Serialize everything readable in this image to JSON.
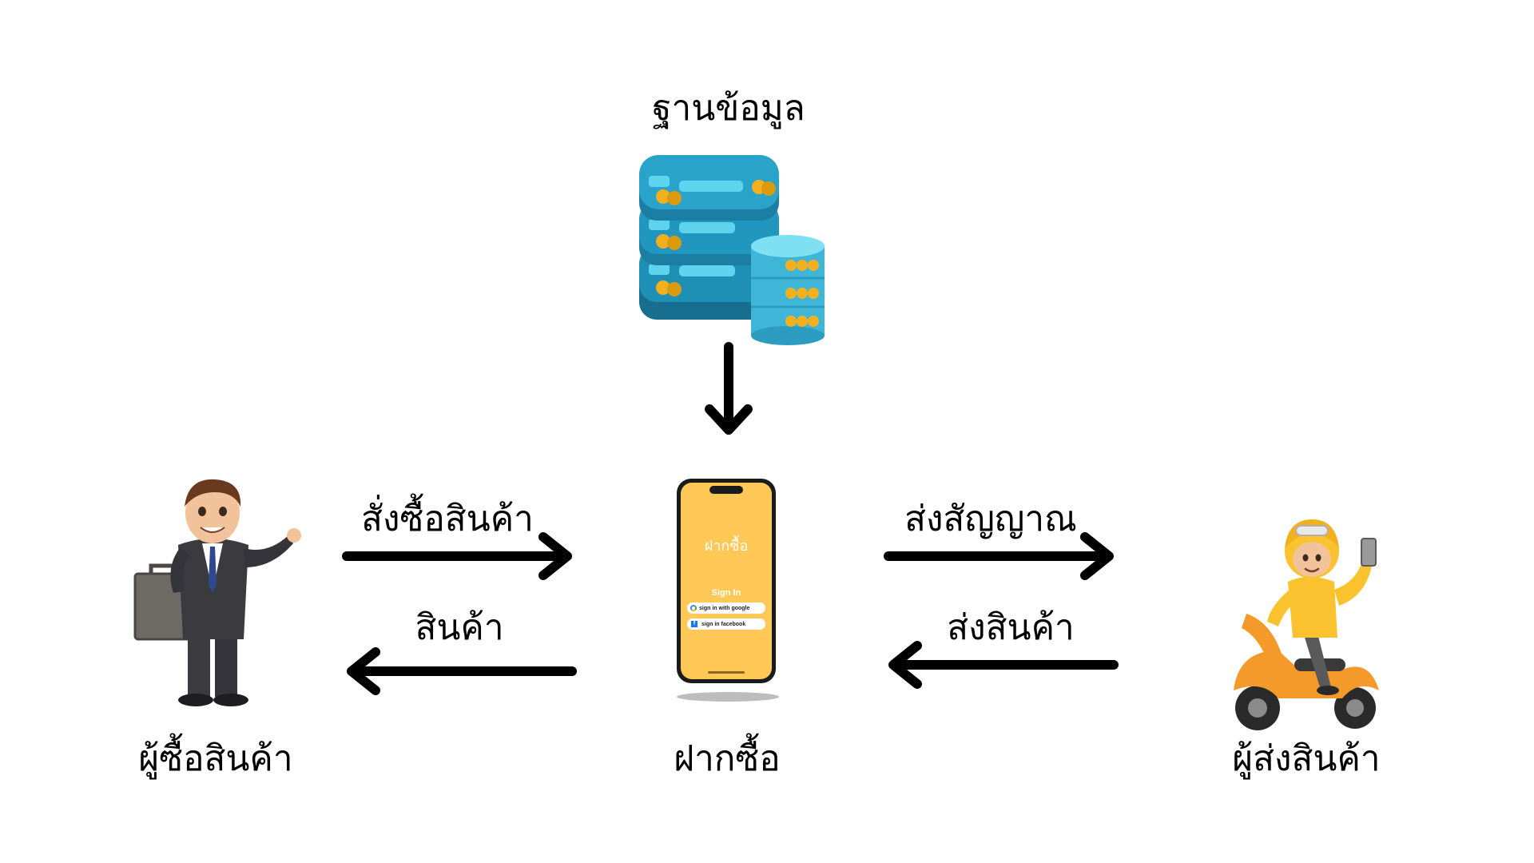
{
  "diagram": {
    "nodes": {
      "database": {
        "label": "ฐานข้อมูล",
        "icon": "database-server-icon"
      },
      "buyer": {
        "label": "ผู้ซื้อสินค้า",
        "icon": "businessman-icon"
      },
      "app": {
        "label": "ฝากซื้อ",
        "icon": "smartphone-icon"
      },
      "courier": {
        "label": "ผู้ส่งสินค้า",
        "icon": "scooter-rider-icon"
      }
    },
    "edges": {
      "buyer_to_app": "สั่งซื้อสินค้า",
      "app_to_buyer": "สินค้า",
      "app_to_courier": "ส่งสัญญาณ",
      "courier_to_app": "ส่งสินค้า",
      "database_to_app": ""
    },
    "phone_screen": {
      "title": "ฝากซื้อ",
      "heading": "Sign In",
      "google_button": "sign in with google",
      "facebook_button": "sign in facebook",
      "background": "#FFC857"
    },
    "colors": {
      "arrow": "#000000",
      "db_blue": "#1E8FB5",
      "db_cyan": "#5ED3EE",
      "db_gold": "#F2B01E",
      "scooter_orange": "#F39A2A",
      "rider_yellow": "#F9C22E",
      "suit": "#3B3B3F"
    }
  }
}
